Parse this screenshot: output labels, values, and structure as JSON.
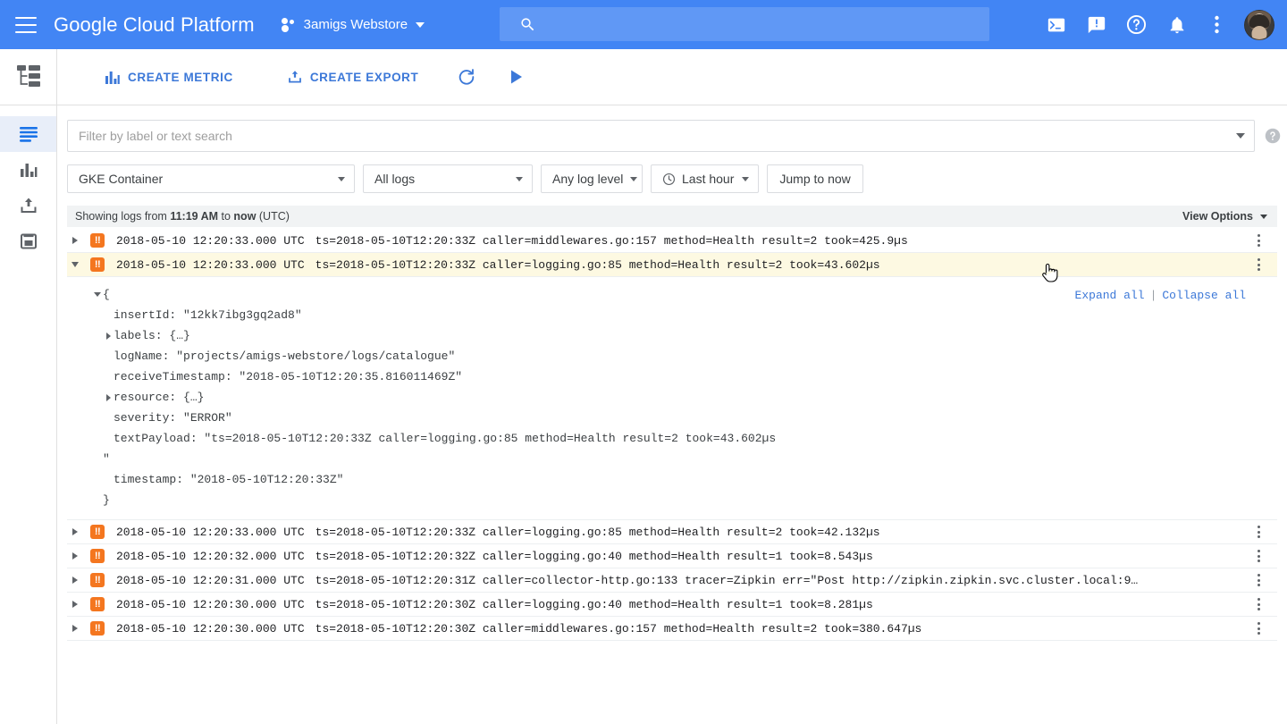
{
  "appbar": {
    "menu_icon": "hamburger-menu-icon",
    "brand": "Google Cloud Platform",
    "project_name": "3amigs Webstore",
    "search_placeholder": "",
    "icons": [
      "cloud-shell-icon",
      "feedback-icon",
      "help-icon",
      "notifications-icon",
      "more-options-icon"
    ],
    "accent_color": "#4285f4"
  },
  "rail": {
    "logo_name": "stackdriver-logging-icon",
    "items": [
      {
        "name": "logs-viewer",
        "icon": "logs-icon",
        "active": true
      },
      {
        "name": "logs-based-metrics",
        "icon": "bar-chart-icon",
        "active": false
      },
      {
        "name": "exports",
        "icon": "export-upload-icon",
        "active": false
      },
      {
        "name": "logs-ingestion",
        "icon": "storage-icon",
        "active": false
      }
    ]
  },
  "toolbar": {
    "create_metric_label": "CREATE METRIC",
    "create_export_label": "CREATE EXPORT",
    "refresh_icon": "refresh-icon",
    "play_icon": "play-icon"
  },
  "filters": {
    "search_placeholder": "Filter by label or text search",
    "search_value": "",
    "help_icon": "help-circle-icon",
    "resource": "GKE Container",
    "logs": "All logs",
    "log_level": "Any log level",
    "time_range": "Last hour",
    "jump_to_now": "Jump to now"
  },
  "band": {
    "prefix": "Showing logs from ",
    "from_time": "11:19 AM",
    "middle": " to ",
    "to_time": "now",
    "suffix": " (UTC)",
    "view_options": "View Options"
  },
  "log_rows": [
    {
      "severity": "ERROR",
      "severity_glyph": "!!",
      "timestamp": "2018-05-10 12:20:33.000 UTC",
      "message": "ts=2018-05-10T12:20:33Z caller=middlewares.go:157 method=Health result=2 took=425.9µs",
      "expanded": false,
      "highlighted": false
    },
    {
      "severity": "ERROR",
      "severity_glyph": "!!",
      "timestamp": "2018-05-10 12:20:33.000 UTC",
      "message": "ts=2018-05-10T12:20:33Z caller=logging.go:85 method=Health result=2 took=43.602µs",
      "expanded": true,
      "highlighted": true
    },
    {
      "severity": "ERROR",
      "severity_glyph": "!!",
      "timestamp": "2018-05-10 12:20:33.000 UTC",
      "message": "ts=2018-05-10T12:20:33Z caller=logging.go:85 method=Health result=2 took=42.132µs",
      "expanded": false,
      "highlighted": false
    },
    {
      "severity": "ERROR",
      "severity_glyph": "!!",
      "timestamp": "2018-05-10 12:20:32.000 UTC",
      "message": "ts=2018-05-10T12:20:32Z caller=logging.go:40 method=Health result=1 took=8.543µs",
      "expanded": false,
      "highlighted": false
    },
    {
      "severity": "ERROR",
      "severity_glyph": "!!",
      "timestamp": "2018-05-10 12:20:31.000 UTC",
      "message": "ts=2018-05-10T12:20:31Z caller=collector-http.go:133 tracer=Zipkin err=\"Post http://zipkin.zipkin.svc.cluster.local:9…",
      "expanded": false,
      "highlighted": false
    },
    {
      "severity": "ERROR",
      "severity_glyph": "!!",
      "timestamp": "2018-05-10 12:20:30.000 UTC",
      "message": "ts=2018-05-10T12:20:30Z caller=logging.go:40 method=Health result=1 took=8.281µs",
      "expanded": false,
      "highlighted": false
    },
    {
      "severity": "ERROR",
      "severity_glyph": "!!",
      "timestamp": "2018-05-10 12:20:30.000 UTC",
      "message": "ts=2018-05-10T12:20:30Z caller=middlewares.go:157 method=Health result=2 took=380.647µs",
      "expanded": false,
      "highlighted": false
    }
  ],
  "detail": {
    "expand_all": "Expand all",
    "separator": "|",
    "collapse_all": "Collapse all",
    "open_brace": "{",
    "close_brace": "}",
    "insert_id": "insertId: \"12kk7ibg3gq2ad8\"",
    "labels": "labels: {…}",
    "log_name": "logName: \"projects/amigs-webstore/logs/catalogue\"",
    "receive_timestamp": "receiveTimestamp: \"2018-05-10T12:20:35.816011469Z\"",
    "resource": "resource: {…}",
    "severity": "severity: \"ERROR\"",
    "text_payload": "textPayload: \"ts=2018-05-10T12:20:33Z caller=logging.go:85 method=Health result=2 took=43.602µs",
    "text_payload_close": "\"",
    "timestamp": "timestamp: \"2018-05-10T12:20:33Z\""
  }
}
